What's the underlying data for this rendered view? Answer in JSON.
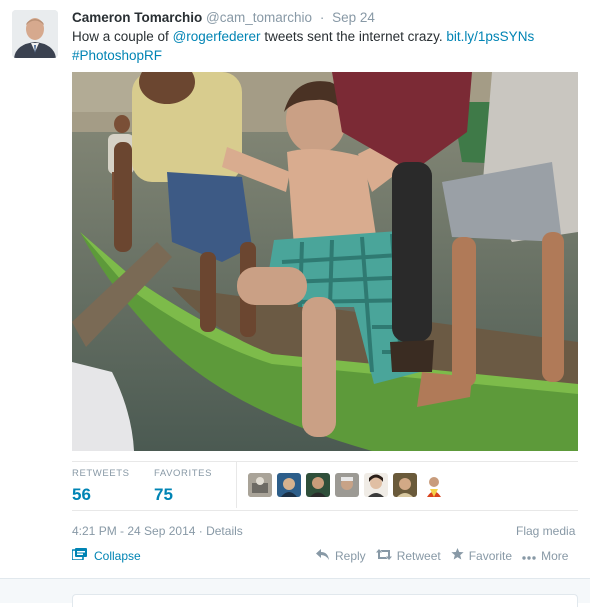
{
  "tweet": {
    "fullname": "Cameron Tomarchio",
    "screenname": "@cam_tomarchio",
    "time": "Sep 24",
    "text_prefix": "How a couple of ",
    "mention": "@rogerfederer",
    "text_middle": " tweets sent the internet crazy. ",
    "url": "bit.ly/1psSYNs",
    "hashtag": "#PhotoshopRF"
  },
  "stats": {
    "retweets_label": "RETWEETS",
    "retweets_value": "56",
    "favorites_label": "FAVORITES",
    "favorites_value": "75"
  },
  "meta": {
    "timestamp": "4:21 PM - 24 Sep 2014",
    "separator": " · ",
    "details": "Details",
    "flag_media": "Flag media"
  },
  "actions": {
    "collapse": "Collapse",
    "reply": "Reply",
    "retweet": "Retweet",
    "favorite": "Favorite",
    "more": "More"
  },
  "colors": {
    "link": "#0084b4",
    "muted": "#8899a6",
    "text": "#292f33"
  },
  "icons": [
    "collapse-icon",
    "reply-icon",
    "retweet-icon",
    "favorite-icon",
    "more-icon"
  ]
}
